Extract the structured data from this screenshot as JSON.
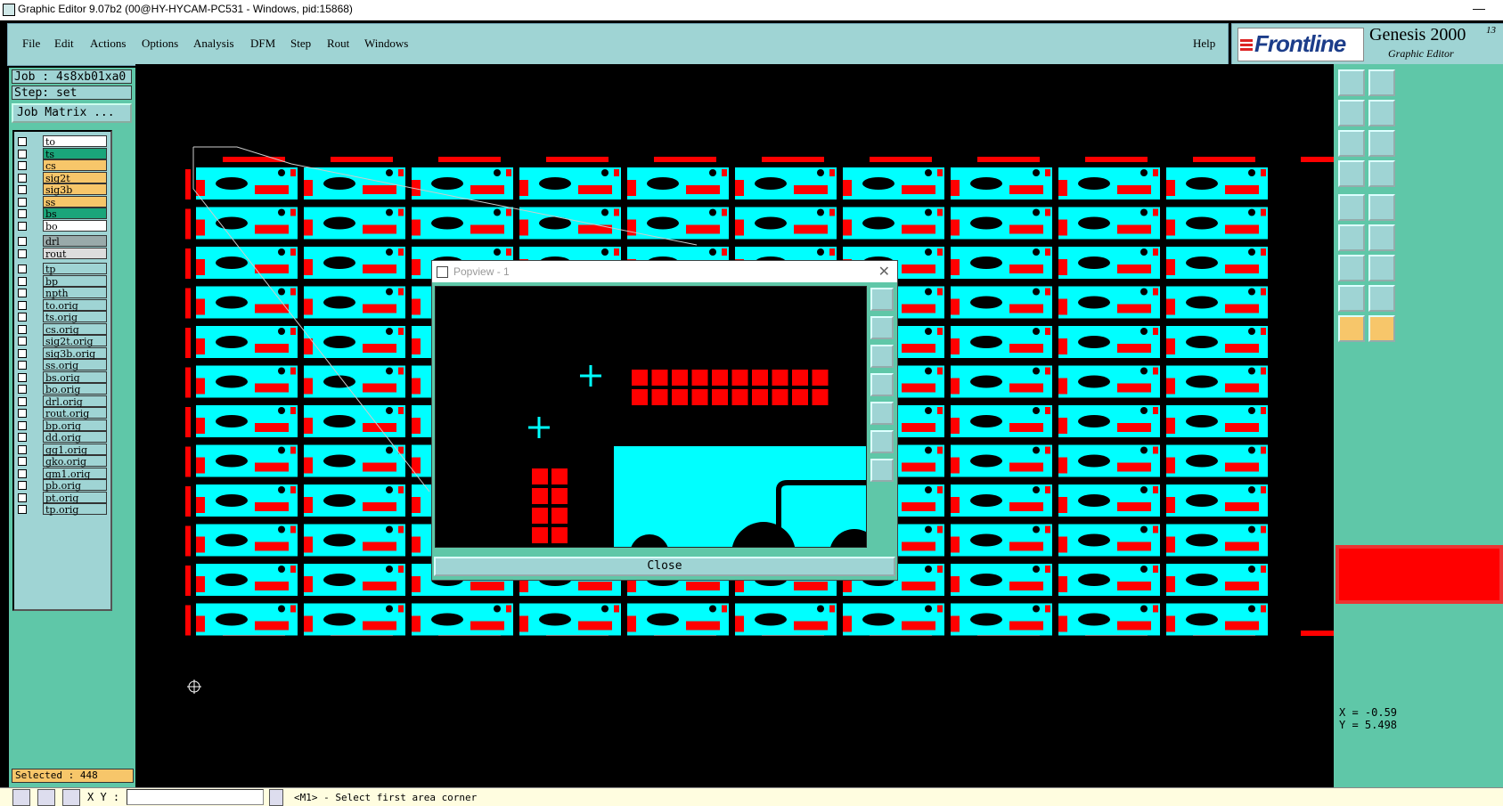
{
  "window": {
    "title": "Graphic Editor 9.07b2 (00@HY-HYCAM-PC531 - Windows, pid:15868)",
    "minimize": "—"
  },
  "menu": {
    "items": [
      "File",
      "Edit",
      "Actions",
      "Options",
      "Analysis",
      "DFM",
      "Step",
      "Rout",
      "Windows"
    ],
    "help": "Help"
  },
  "brand": {
    "logo": "Frontline",
    "product": "Genesis 2000",
    "subtitle": "Graphic Editor",
    "version": "13"
  },
  "job": {
    "job_label": "Job : 4s8xb01xa0",
    "step_label": "Step: set",
    "matrix_button": "Job Matrix ..."
  },
  "layers": {
    "board": [
      {
        "name": "to",
        "color": "#ffffff"
      },
      {
        "name": "ts",
        "color": "#1aa57a"
      },
      {
        "name": "cs",
        "color": "#f7c66a"
      },
      {
        "name": "sig2t",
        "color": "#f7c66a"
      },
      {
        "name": "sig3b",
        "color": "#f7c66a"
      },
      {
        "name": "ss",
        "color": "#f7c66a"
      },
      {
        "name": "bs",
        "color": "#1aa57a"
      },
      {
        "name": "bo",
        "color": "#ffffff"
      }
    ],
    "drill": [
      {
        "name": "drl",
        "color": "#9aa"
      },
      {
        "name": "rout",
        "color": "#ddd"
      }
    ],
    "misc": [
      "tp",
      "bp",
      "npth",
      "to.orig",
      "ts.orig",
      "cs.orig",
      "sig2t.orig",
      "sig3b.orig",
      "ss.orig",
      "bs.orig",
      "bo.orig",
      "drl.orig",
      "rout.orig",
      "bp.orig",
      "dd.orig",
      "gg1.orig",
      "gko.orig",
      "gm1.orig",
      "pb.orig",
      "pt.orig",
      "tp.orig"
    ]
  },
  "selected": "Selected : 448",
  "popview": {
    "title": "Popview - 1",
    "close": "Close",
    "close_x": "✕"
  },
  "coords": {
    "x": "X = -0.59",
    "y": "Y = 5.498"
  },
  "status": {
    "xy_label": "X Y :",
    "xy_value": "",
    "prompt": "<M1> - Select first area corner"
  },
  "colors": {
    "panel": "#5fc7a8",
    "menu": "#9fd4d4",
    "cyan": "#00ffff",
    "red": "#ff0000",
    "highlight": "#f7c66a"
  },
  "icons": [
    "zoom-fit-icon",
    "zoom-in-icon",
    "zoom-out-icon",
    "pan-left-icon",
    "pan-right-icon",
    "zoom-home-icon",
    "center-icon",
    "snap-icon",
    "measure-icon",
    "select-icon"
  ]
}
